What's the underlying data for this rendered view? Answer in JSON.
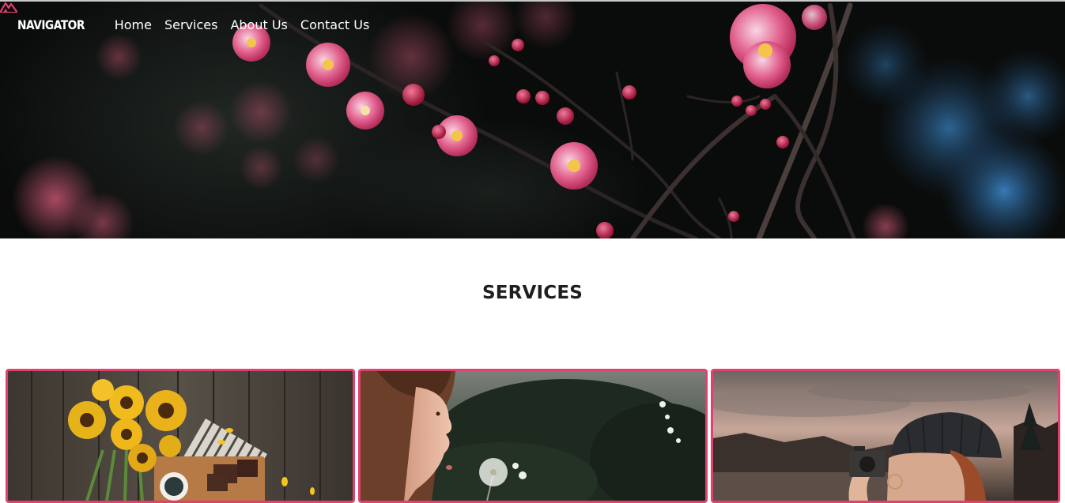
{
  "brand": {
    "name": "NAVIGATOR",
    "accent_color": "#e0416e"
  },
  "nav": {
    "items": [
      {
        "label": "Home"
      },
      {
        "label": "Services"
      },
      {
        "label": "About Us"
      },
      {
        "label": "Contact Us"
      }
    ]
  },
  "hero": {
    "image": "plum-blossom-branch-photo"
  },
  "services": {
    "title": "SERVICES",
    "cards": [
      {
        "image": "sunflowers-coffee-on-wooden-table-photo"
      },
      {
        "image": "girl-blowing-dandelion-photo"
      },
      {
        "image": "person-with-camera-at-sunset-photo"
      }
    ]
  }
}
